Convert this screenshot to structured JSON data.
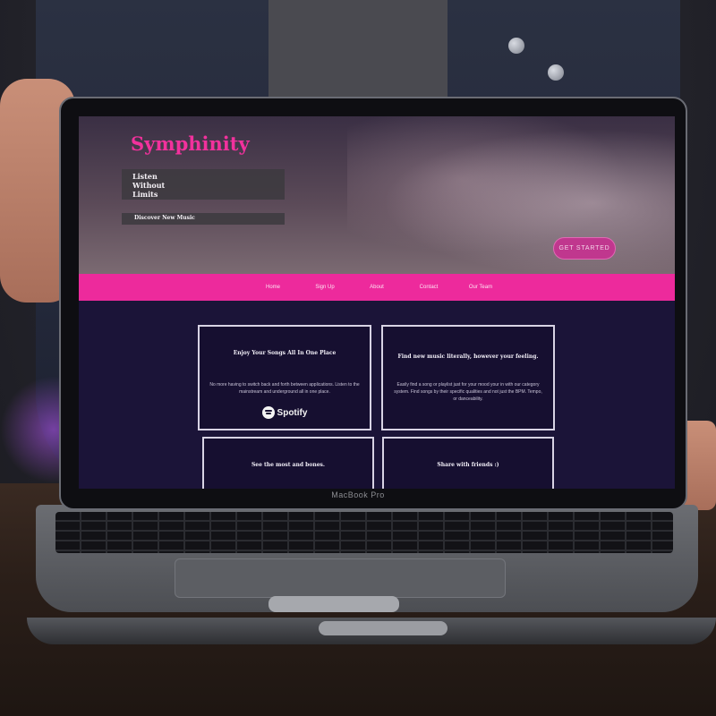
{
  "device": {
    "bezel_label": "MacBook Pro"
  },
  "site": {
    "brand": "Symphinity",
    "tagline": "Listen Without Limits",
    "discover": "Discover New Music",
    "cta": "GET STARTED",
    "nav": [
      "Home",
      "Sign Up",
      "About",
      "Contact",
      "Our Team"
    ],
    "cards": [
      {
        "title": "Enjoy Your Songs All In One Place",
        "text": "No more having to switch back and forth between applications. Listen to the mainstream and underground all in one place.",
        "logo": "Spotify"
      },
      {
        "title": "Find new music literally, however your feeling.",
        "text": "Easily find a song or playlist just for your mood your in with our category system. Find songs by their specific qualities and not just the BPM. Tempo, or danceability."
      },
      {
        "title": "See the most and bones."
      },
      {
        "title": "Share with friends :)"
      }
    ]
  },
  "colors": {
    "brand_pink": "#f2319d",
    "nav_pink": "#ed2a9c",
    "page_bg": "#1b1438",
    "card_border": "#d8d3e4"
  }
}
